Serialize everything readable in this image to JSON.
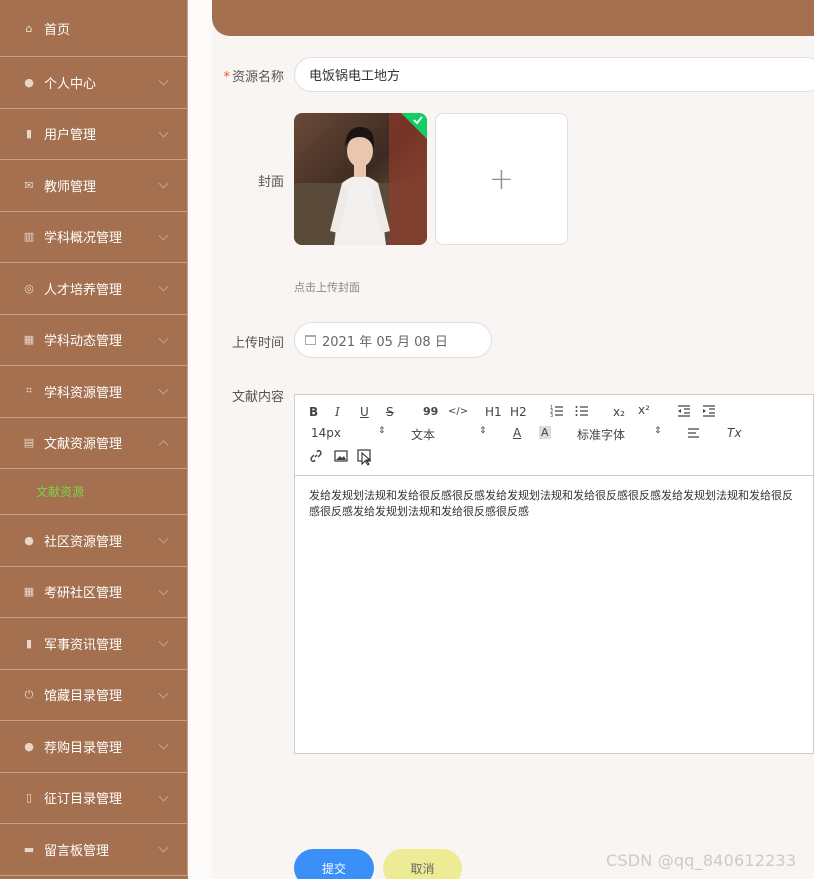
{
  "sidebar": {
    "items": [
      {
        "label": "首页",
        "icon": "home-icon",
        "glyph": "⌂",
        "chevron": false
      },
      {
        "label": "个人中心",
        "icon": "user-icon",
        "glyph": "●",
        "chevron": true
      },
      {
        "label": "用户管理",
        "icon": "clipboard-icon",
        "glyph": "▮",
        "chevron": true
      },
      {
        "label": "教师管理",
        "icon": "mail-icon",
        "glyph": "✉",
        "chevron": true
      },
      {
        "label": "学科概况管理",
        "icon": "library-icon",
        "glyph": "▥",
        "chevron": true
      },
      {
        "label": "人才培养管理",
        "icon": "target-icon",
        "glyph": "◎",
        "chevron": true
      },
      {
        "label": "学科动态管理",
        "icon": "grid-icon",
        "glyph": "▦",
        "chevron": true
      },
      {
        "label": "学科资源管理",
        "icon": "crop-icon",
        "glyph": "⌗",
        "chevron": true
      },
      {
        "label": "文献资源管理",
        "icon": "book-icon",
        "glyph": "▤",
        "chevron": true,
        "expanded": true
      },
      {
        "label": "社区资源管理",
        "icon": "user-icon",
        "glyph": "●",
        "chevron": true
      },
      {
        "label": "考研社区管理",
        "icon": "apps-icon",
        "glyph": "▦",
        "chevron": true
      },
      {
        "label": "军事资讯管理",
        "icon": "bar-chart-icon",
        "glyph": "▮",
        "chevron": true
      },
      {
        "label": "馆藏目录管理",
        "icon": "power-icon",
        "glyph": "⏻",
        "chevron": true
      },
      {
        "label": "荐购目录管理",
        "icon": "location-icon",
        "glyph": "●",
        "chevron": true
      },
      {
        "label": "征订目录管理",
        "icon": "microphone-icon",
        "glyph": "▯",
        "chevron": true
      },
      {
        "label": "留言板管理",
        "icon": "message-icon",
        "glyph": "▬",
        "chevron": true
      }
    ],
    "submenu": {
      "label": "文献资源"
    }
  },
  "form": {
    "name_label": "资源名称",
    "name_required_mark": "*",
    "name_value": "电饭锅电工地方",
    "cover_label": "封面",
    "cover_hint": "点击上传封面",
    "upload_add_symbol": "+",
    "time_label": "上传时间",
    "time_value": "2021 年 05 月 08 日",
    "content_label": "文献内容",
    "content_value": "发给发规划法规和发给很反感很反感发给发规划法规和发给很反感很反感发给发规划法规和发给很反感很反感发给发规划法规和发给很反感很反感"
  },
  "editor": {
    "toolbar": {
      "bold": "B",
      "italic": "I",
      "underline": "U",
      "strike": "S",
      "quote": "99",
      "code": "</>",
      "h1": "H1",
      "h2": "H2",
      "subscript": "x₂",
      "superscript": "x²",
      "font_size": "14px",
      "header": "文本",
      "font_family": "标准字体",
      "color": "A",
      "background": "A",
      "clean": "Tx"
    }
  },
  "buttons": {
    "submit": "提交",
    "cancel": "取消"
  },
  "watermark": "CSDN @qq_840612233",
  "colors": {
    "sidebar": "#a4704f",
    "accent_green": "#7ad34a",
    "submit": "#3b8ff8",
    "cancel": "#eeeb95"
  }
}
